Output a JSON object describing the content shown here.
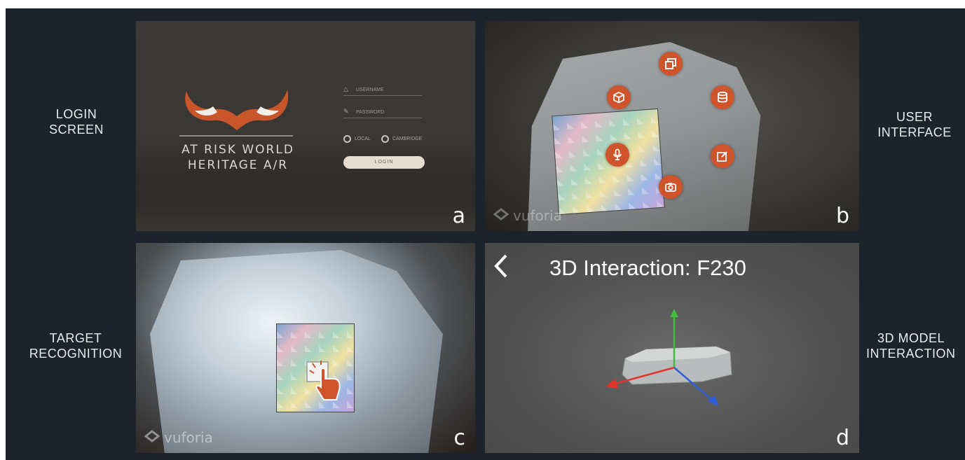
{
  "labels": {
    "login_screen": [
      "LOGIN",
      "SCREEN"
    ],
    "user_interface": [
      "USER",
      "INTERFACE"
    ],
    "target_recognition": [
      "TARGET",
      "RECOGNITION"
    ],
    "model_interaction": [
      "3D MODEL",
      "INTERACTION"
    ]
  },
  "panel_a": {
    "letter": "a",
    "app_title": [
      "AT RISK WORLD",
      "HERITAGE A/R"
    ],
    "username_placeholder": "USERNAME",
    "password_placeholder": "PASSWORD",
    "radio_local": "LOCAL",
    "radio_cambridge": "CAMBRIDGE",
    "login_button": "LOGIN",
    "brand_color": "#d0542b"
  },
  "panel_b": {
    "letter": "b",
    "watermark": "vuforia",
    "buttons": [
      "copy-icon",
      "cube-icon",
      "database-icon",
      "microphone-icon",
      "edit-icon",
      "camera-icon"
    ]
  },
  "panel_c": {
    "letter": "c",
    "watermark": "vuforia"
  },
  "panel_d": {
    "letter": "d",
    "title": "3D Interaction: F230",
    "back_glyph": "<"
  }
}
